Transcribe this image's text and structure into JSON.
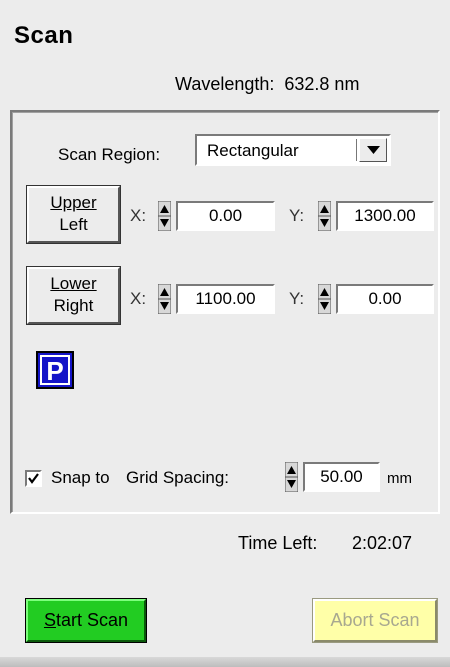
{
  "panel": {
    "title": "Scan",
    "wavelength_label": "Wavelength:",
    "wavelength_value": "632.8 nm"
  },
  "region": {
    "label": "Scan Region:",
    "selected": "Rectangular"
  },
  "upper_left": {
    "button_line1": "Upper",
    "button_line2": "Left",
    "x_label": "X:",
    "x_value": "0.00",
    "y_label": "Y:",
    "y_value": "1300.00"
  },
  "lower_right": {
    "button_line1": "Lower",
    "button_line2": "Right",
    "x_label": "X:",
    "x_value": "1100.00",
    "y_label": "Y:",
    "y_value": "0.00"
  },
  "p_button": {
    "label": "P",
    "color": "#1414c8"
  },
  "snap": {
    "checked": true,
    "label": "Snap to",
    "spacing_label": "Grid Spacing:",
    "spacing_value": "50.00",
    "unit": "mm"
  },
  "time": {
    "label": "Time Left:",
    "value": "2:02:07"
  },
  "actions": {
    "start_label": "Start Scan",
    "start_color": "#22cc22",
    "abort_label": "Abort Scan",
    "abort_color": "#ffffa8",
    "abort_enabled": false
  },
  "icons": [
    "dropdown-arrow-icon",
    "spin-arrows-icon",
    "checkmark-icon",
    "p-icon"
  ]
}
